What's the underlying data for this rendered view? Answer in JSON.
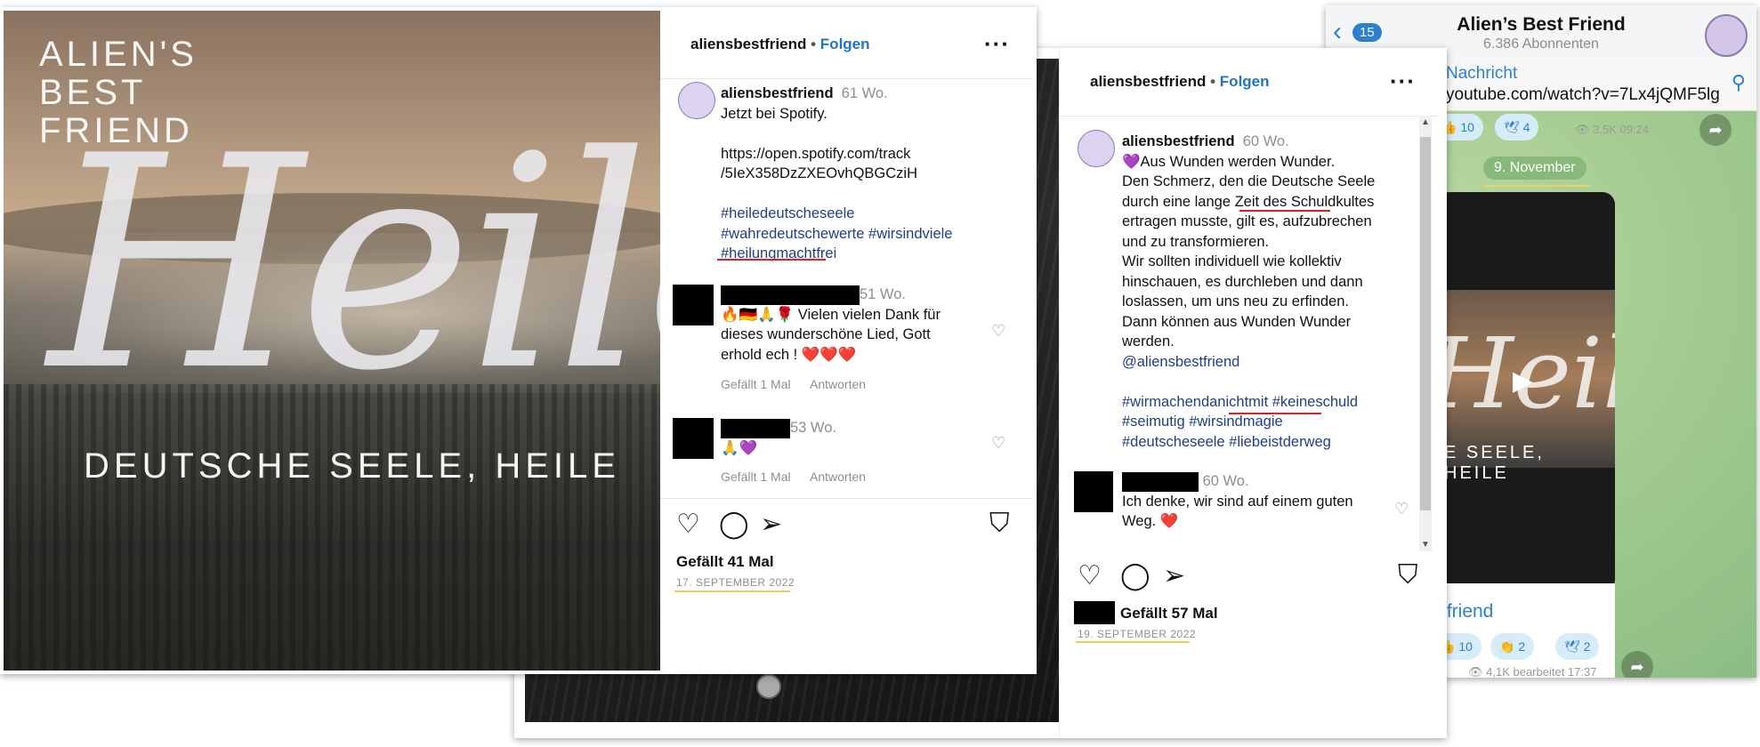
{
  "telegram": {
    "back_count": "15",
    "title": "Alien’s Best Friend",
    "subscribers": "6.386 Abonnenten",
    "pinned_label": "Nachricht",
    "pinned_text": "youtube.com/watch?v=7Lx4jQMF5lg",
    "top_reactions": [
      "10",
      "4"
    ],
    "top_meta": "3,5K 09:24",
    "date_chip": "9. November",
    "video_overlay_sub": "E SEELE, HEILE",
    "bubble_name": "tfriend",
    "bottom_reactions": [
      "10",
      "2",
      "2"
    ],
    "bottom_meta": "4,1K bearbeitet 17:37"
  },
  "post1": {
    "image": {
      "brand_lines": [
        "ALIEN'S",
        "BEST",
        "FRIEND"
      ],
      "script_text": "Heile,",
      "tagline": "DEUTSCHE SEELE, HEILE"
    },
    "username": "aliensbestfriend",
    "follow": "Folgen",
    "age": "61 Wo.",
    "caption": [
      "Jetzt bei Spotify."
    ],
    "link": [
      "https://open.spotify.com/track",
      "/5IeX358DzZXEOvhQBGCziH"
    ],
    "hashtags": [
      "#heiledeutscheseele",
      "#wahredeutschewerte #wirsindviele",
      "#heilungmachtfrei"
    ],
    "comments": [
      {
        "age": "51 Wo.",
        "text": [
          "🔥🇩🇪🙏🌹 Vielen vielen Dank für",
          "dieses wunderschöne Lied, Gott",
          "erhold ech ! ❤️❤️❤️"
        ],
        "likes": "Gefällt 1 Mal",
        "reply": "Antworten"
      },
      {
        "age": "53 Wo.",
        "text": [
          "🙏💜"
        ],
        "likes": "Gefällt 1 Mal",
        "reply": "Antworten"
      }
    ],
    "likes": "Gefällt 41 Mal",
    "date": "17. SEPTEMBER 2022"
  },
  "post2": {
    "username": "aliensbestfriend",
    "follow": "Folgen",
    "age": "60 Wo.",
    "caption": [
      "💜Aus Wunden werden Wunder.",
      "Den Schmerz, den die Deutsche Seele",
      "durch eine lange Zeit des Schuldkultes",
      "ertragen musste, gilt es, aufzubrechen",
      "und zu transformieren.",
      "Wir sollten individuell wie kollektiv",
      "hinschauen, es durchleben und dann",
      "loslassen, um uns neu zu erfinden.",
      "Dann können aus Wunden Wunder",
      "werden."
    ],
    "mention": "@aliensbestfriend",
    "hashtags": [
      "#wirmachendanichtmit #keineschuld",
      "#seimutig #wirsindmagie",
      "#deutscheseele #liebeistderweg"
    ],
    "comment": {
      "age": "60 Wo.",
      "text": [
        "Ich denke, wir sind auf einem guten",
        "Weg. ❤️"
      ]
    },
    "likes": "Gefällt 57 Mal",
    "date": "19. SEPTEMBER 2022"
  },
  "colors": {
    "link_blue": "#1f74c5",
    "hashtag": "#1f3f8a",
    "red_underline": "#d6232a",
    "yellow_underline": "#e8cf5c",
    "telegram_blue": "#2f7fd1"
  }
}
